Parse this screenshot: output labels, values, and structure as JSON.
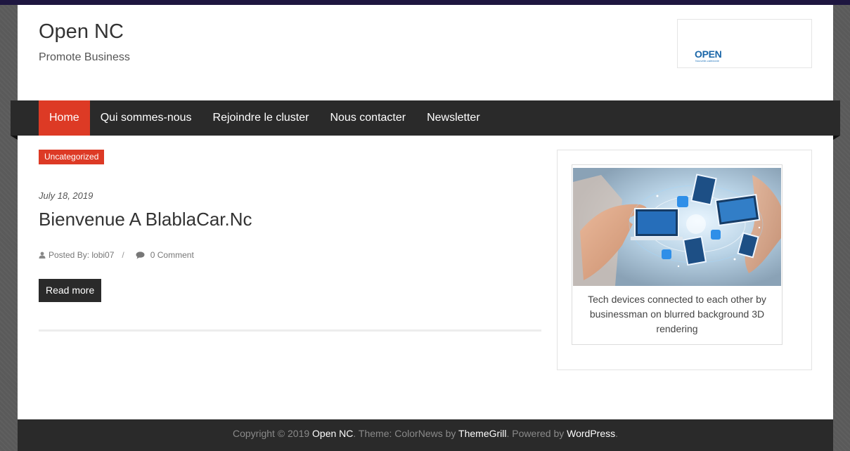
{
  "site": {
    "title": "Open NC",
    "tagline": "Promote Business"
  },
  "header_logo": {
    "word": "OPEN",
    "sub": "Nouvelle-calédonie"
  },
  "nav": {
    "items": [
      {
        "label": "Home",
        "active": true
      },
      {
        "label": "Qui sommes-nous",
        "active": false
      },
      {
        "label": "Rejoindre le cluster",
        "active": false
      },
      {
        "label": "Nous contacter",
        "active": false
      },
      {
        "label": "Newsletter",
        "active": false
      }
    ]
  },
  "post": {
    "category": "Uncategorized",
    "date": "July 18, 2019",
    "title": "Bienvenue A BlablaCar.Nc",
    "author": "Posted By: lobi07",
    "separator": "/",
    "comments": "0 Comment",
    "read_more": "Read more"
  },
  "widget": {
    "caption": "Tech devices connected to each other by businessman on blurred background 3D rendering"
  },
  "footer": {
    "copyright": "Copyright © 2019 ",
    "site_link": "Open NC",
    "theme_text": ". Theme: ColorNews by ",
    "theme_link": "ThemeGrill",
    "powered_text": ". Powered by ",
    "wp_link": "WordPress",
    "end": "."
  },
  "colors": {
    "accent": "#dd3a25",
    "nav_bg": "#2a2a2a"
  }
}
